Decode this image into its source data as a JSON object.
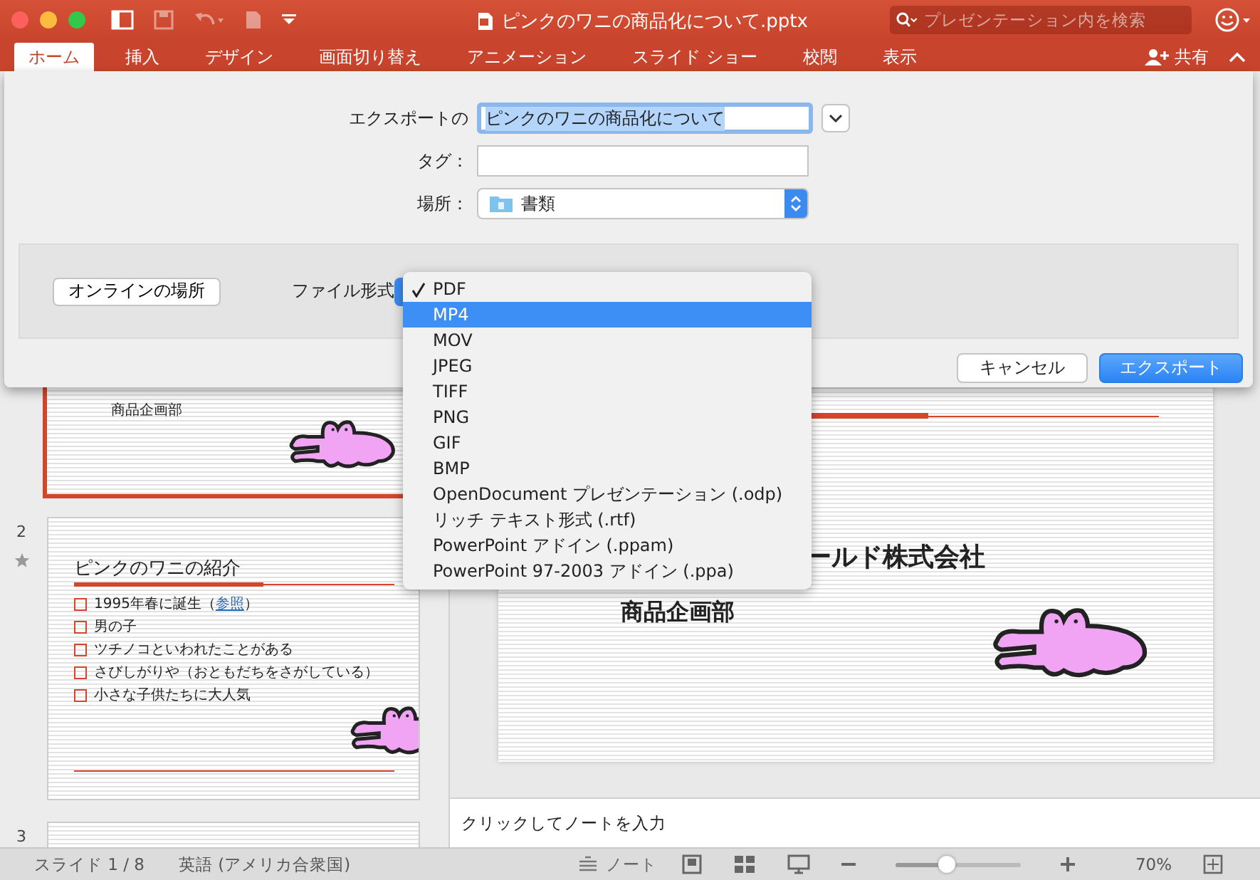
{
  "window": {
    "title": "ピンクのワニの商品化について.pptx",
    "search": {
      "placeholder": "プレゼンテーション内を検索"
    }
  },
  "ribbon_tabs": [
    {
      "label": "ホーム",
      "selected": true
    },
    {
      "label": "挿入",
      "selected": false
    },
    {
      "label": "デザイン",
      "selected": false
    },
    {
      "label": "画面切り替え",
      "selected": false
    },
    {
      "label": "アニメーション",
      "selected": false
    },
    {
      "label": "スライド ショー",
      "selected": false
    },
    {
      "label": "校閲",
      "selected": false
    },
    {
      "label": "表示",
      "selected": false
    }
  ],
  "share": "共有",
  "thumbnails": [
    {
      "selected": true,
      "lines": [
        "商品企画部"
      ]
    },
    {
      "number": "2",
      "selected": false,
      "starred": true,
      "title": "ピンクのワニの紹介",
      "bullets": [
        {
          "text": "1995年春に誕生（",
          "link": "参照",
          "suffix": "）"
        },
        {
          "text": "男の子"
        },
        {
          "text": "ツチノコといわれたことがある"
        },
        {
          "text": "さびしがりや（おともだちをさがしている）"
        },
        {
          "text": "小さな子供たちに大人気"
        }
      ]
    },
    {
      "number": "3",
      "selected": false
    }
  ],
  "slide": {
    "lines": [
      "ールド株式会社",
      "商品企画部"
    ]
  },
  "notes": {
    "placeholder": "クリックしてノートを入力"
  },
  "status_bar": {
    "slide": "スライド 1 / 8",
    "language": "英語 (アメリカ合衆国)",
    "notes": "ノート",
    "zoom": {
      "level": 0.4,
      "reading": "70%"
    }
  },
  "dialog": {
    "export_as": {
      "label": "エクスポートの",
      "value": "ピンクのワニの商品化について"
    },
    "tags": {
      "label": "タグ："
    },
    "location": {
      "label": "場所：",
      "value": "書類"
    },
    "online_button": "オンラインの場所",
    "format_label": "ファイル形式",
    "format_menu": [
      {
        "label": "PDF",
        "checked": true,
        "selected": false
      },
      {
        "label": "MP4",
        "checked": false,
        "selected": true
      },
      {
        "label": "MOV",
        "checked": false,
        "selected": false
      },
      {
        "label": "JPEG",
        "checked": false,
        "selected": false
      },
      {
        "label": "TIFF",
        "checked": false,
        "selected": false
      },
      {
        "label": "PNG",
        "checked": false,
        "selected": false
      },
      {
        "label": "GIF",
        "checked": false,
        "selected": false
      },
      {
        "label": "BMP",
        "checked": false,
        "selected": false
      },
      {
        "label": "OpenDocument プレゼンテーション (.odp)",
        "checked": false,
        "selected": false
      },
      {
        "label": "リッチ テキスト形式 (.rtf)",
        "checked": false,
        "selected": false
      },
      {
        "label": "PowerPoint アドイン (.ppam)",
        "checked": false,
        "selected": false
      },
      {
        "label": "PowerPoint 97-2003 アドイン (.ppa)",
        "checked": false,
        "selected": false
      }
    ],
    "buttons": [
      {
        "label": "キャンセル",
        "kind": "secondary"
      },
      {
        "label": "エクスポート",
        "kind": "primary"
      }
    ]
  }
}
